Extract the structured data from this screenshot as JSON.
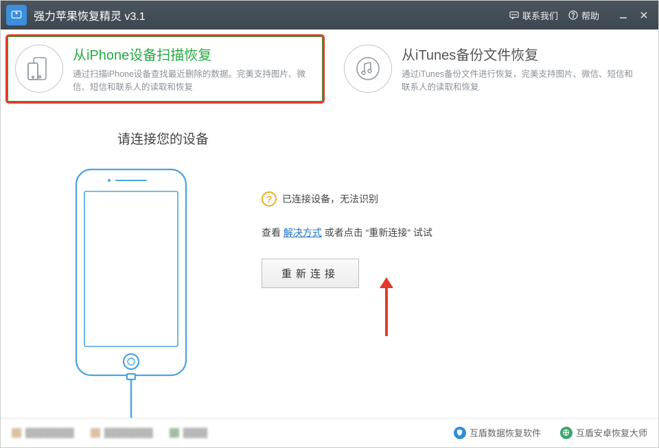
{
  "titlebar": {
    "app_name": "强力苹果恢复精灵 v3.1",
    "contact_label": "联系我们",
    "help_label": "帮助"
  },
  "modes": {
    "scan": {
      "title": "从iPhone设备扫描恢复",
      "desc": "通过扫描iPhone设备查找最近删除的数据。完美支持图片、微信、短信和联系人的读取和恢复"
    },
    "itunes": {
      "title": "从iTunes备份文件恢复",
      "desc": "通过iTunes备份文件进行恢复，完美支持图片、微信、短信和联系人的读取和恢复"
    }
  },
  "main": {
    "heading": "请连接您的设备",
    "status": "已连接设备，无法识别",
    "help_prefix": "查看 ",
    "help_link": "解决方式",
    "help_mid": " 或者点击 “",
    "help_action": "重新连接",
    "help_suffix": "” 试试",
    "reconnect_btn": "重新连接"
  },
  "footer": {
    "badge1": "互盾数据恢复软件",
    "badge2": "互盾安卓恢复大师"
  }
}
